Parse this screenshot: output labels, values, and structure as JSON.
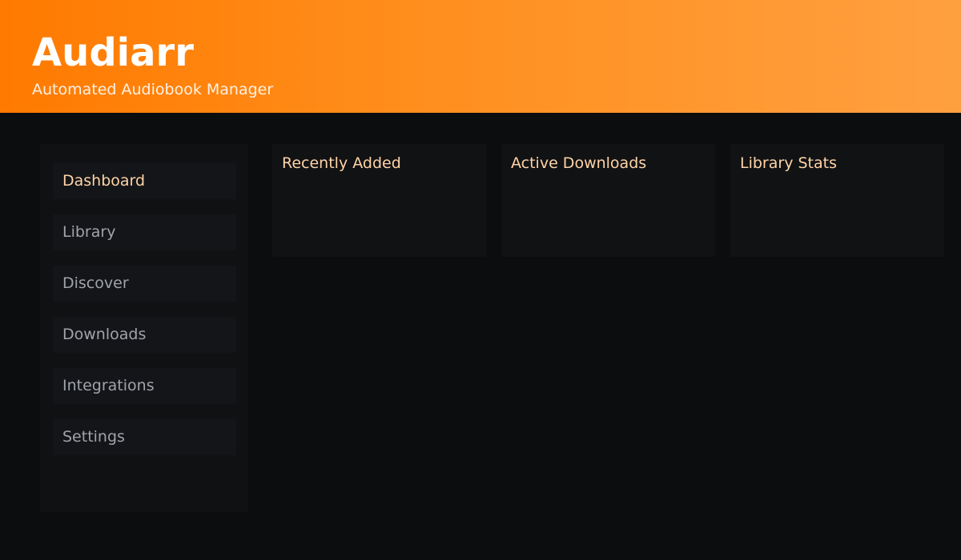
{
  "header": {
    "title": "Audiarr",
    "subtitle": "Automated Audiobook Manager"
  },
  "sidebar": {
    "active": "Dashboard",
    "items": [
      {
        "label": "Dashboard"
      },
      {
        "label": "Library"
      },
      {
        "label": "Discover"
      },
      {
        "label": "Downloads"
      },
      {
        "label": "Integrations"
      },
      {
        "label": "Settings"
      }
    ]
  },
  "cards": [
    {
      "title": "Recently Added"
    },
    {
      "title": "Active Downloads"
    },
    {
      "title": "Library Stats"
    }
  ],
  "colors": {
    "brand_start": "#ff7a00",
    "brand_end": "#ffa040",
    "background": "#0c0d0f",
    "panel": "#111214",
    "accent_text": "#ffd4a6",
    "muted_text": "#a0a3aa"
  }
}
